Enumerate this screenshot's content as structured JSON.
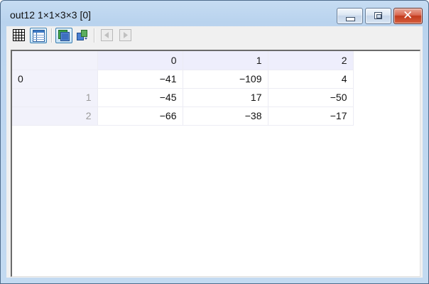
{
  "window": {
    "title": "out12 1×1×3×3 [0]"
  },
  "toolbar": {
    "buttons": [
      {
        "name": "grid-view",
        "icon": "grid-icon",
        "active": false
      },
      {
        "name": "table-view",
        "icon": "table-icon",
        "active": true
      },
      {
        "name": "layer-view",
        "icon": "layers-icon",
        "active": true
      },
      {
        "name": "swap-view",
        "icon": "swap-icon",
        "active": false
      },
      {
        "name": "previous",
        "icon": "previous-icon",
        "enabled": false
      },
      {
        "name": "next",
        "icon": "next-icon",
        "enabled": false
      }
    ]
  },
  "table": {
    "columns": [
      "0",
      "1",
      "2"
    ],
    "rows": [
      {
        "label": "0",
        "values": [
          "−41",
          "−109",
          "4"
        ]
      },
      {
        "label": "1",
        "values": [
          "−45",
          "17",
          "−50"
        ]
      },
      {
        "label": "2",
        "values": [
          "−66",
          "−38",
          "−17"
        ]
      }
    ]
  },
  "colors": {
    "title_bar": "#bcd5ef",
    "header_bg": "#eeeefc",
    "close_button": "#c23a1d"
  }
}
